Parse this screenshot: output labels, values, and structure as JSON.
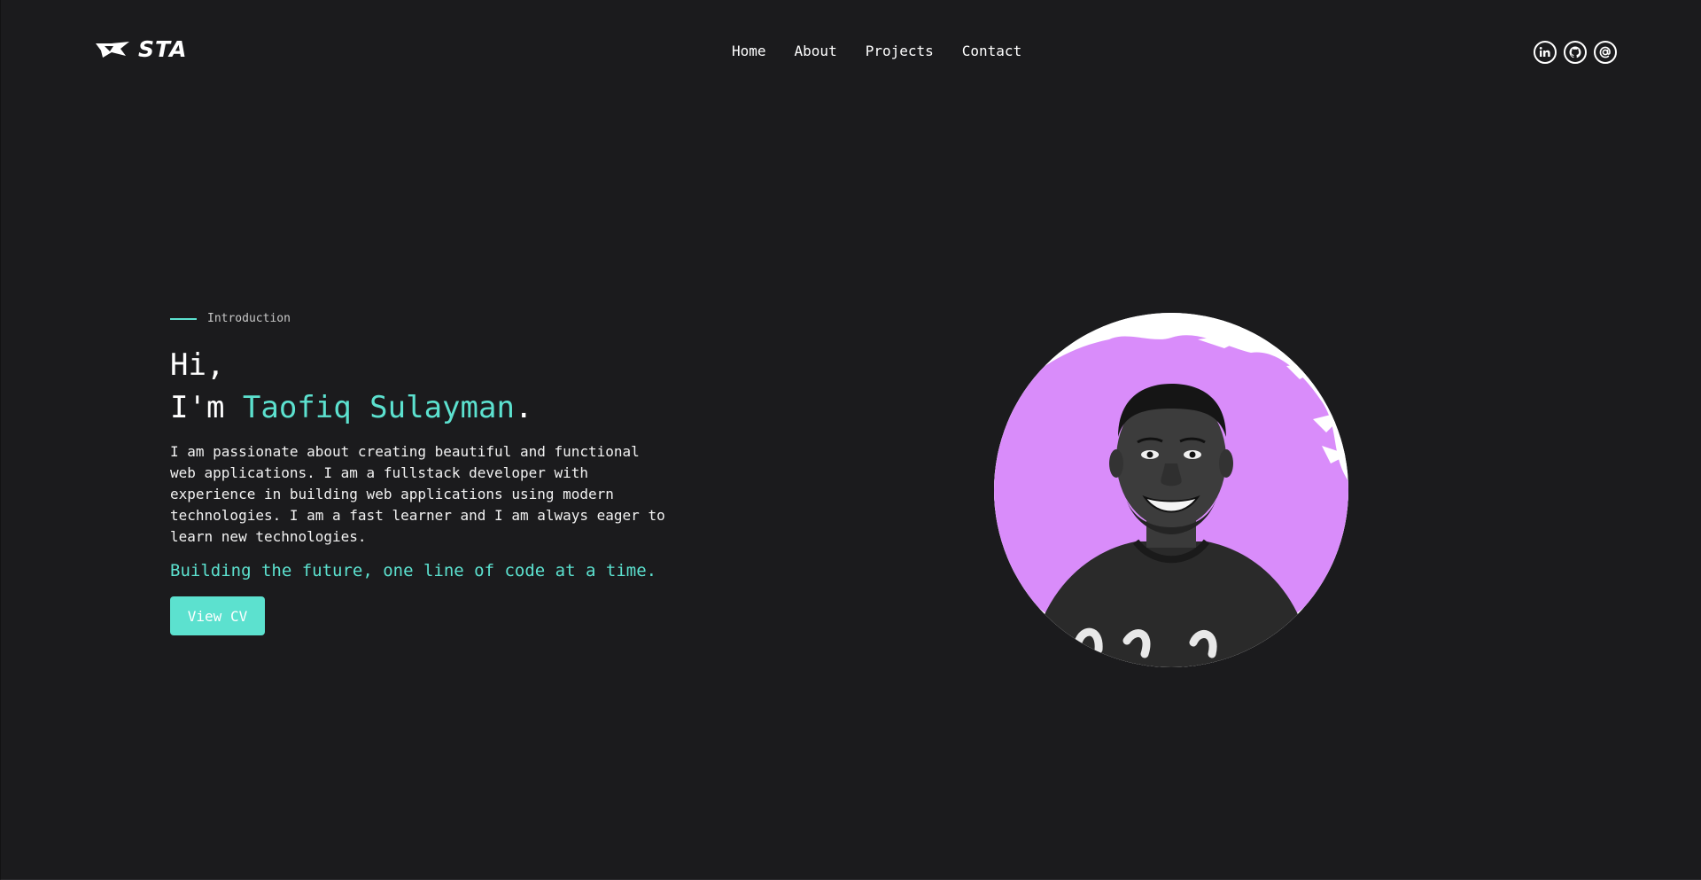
{
  "logo": {
    "text": "STA",
    "icon": "sta-logo-icon"
  },
  "nav": {
    "items": [
      {
        "label": "Home"
      },
      {
        "label": "About"
      },
      {
        "label": "Projects"
      },
      {
        "label": "Contact"
      }
    ]
  },
  "socials": [
    {
      "icon": "linkedin-icon"
    },
    {
      "icon": "github-icon"
    },
    {
      "icon": "email-icon"
    }
  ],
  "hero": {
    "intro_label": "Introduction",
    "greeting": "Hi,",
    "im_prefix": "I'm ",
    "name": "Taofiq Sulayman",
    "name_suffix": ".",
    "bio": "I am passionate about creating beautiful and functional web applications. I am a fullstack developer with experience in building web applications using modern technologies. I am a fast learner and I am always eager to learn new technologies.",
    "tagline": "Building the future, one line of code at a time.",
    "cv_button": "View CV"
  },
  "colors": {
    "background": "#1b1b1d",
    "accent": "#5ce1cf",
    "portrait_splash": "#d98cfa",
    "text": "#ffffff"
  }
}
